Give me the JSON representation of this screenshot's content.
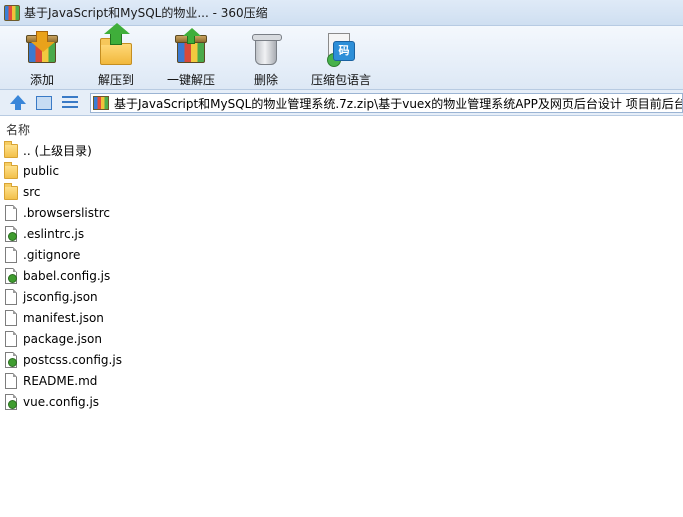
{
  "window": {
    "title": "基于JavaScript和MySQL的物业... - 360压缩"
  },
  "toolbar": {
    "buttons": [
      {
        "label": "添加",
        "icon": "add-archive-icon"
      },
      {
        "label": "解压到",
        "icon": "extract-to-icon"
      },
      {
        "label": "一键解压",
        "icon": "one-click-extract-icon"
      },
      {
        "label": "删除",
        "icon": "delete-icon"
      },
      {
        "label": "压缩包语言",
        "icon": "archive-language-icon"
      }
    ],
    "lang_badge": "码"
  },
  "address": {
    "path": "基于JavaScript和MySQL的物业管理系统.7z.zip\\基于vuex的物业管理系统APP及网页后台设计 项目前后台源"
  },
  "filelist": {
    "column_name": "名称",
    "files": [
      {
        "name": ".. (上级目录)",
        "type": "folder"
      },
      {
        "name": "public",
        "type": "folder"
      },
      {
        "name": "src",
        "type": "folder"
      },
      {
        "name": ".browserslistrc",
        "type": "file"
      },
      {
        "name": ".eslintrc.js",
        "type": "js"
      },
      {
        "name": ".gitignore",
        "type": "file"
      },
      {
        "name": "babel.config.js",
        "type": "js"
      },
      {
        "name": "jsconfig.json",
        "type": "file"
      },
      {
        "name": "manifest.json",
        "type": "file"
      },
      {
        "name": "package.json",
        "type": "file"
      },
      {
        "name": "postcss.config.js",
        "type": "js"
      },
      {
        "name": "README.md",
        "type": "file"
      },
      {
        "name": "vue.config.js",
        "type": "js"
      }
    ]
  }
}
